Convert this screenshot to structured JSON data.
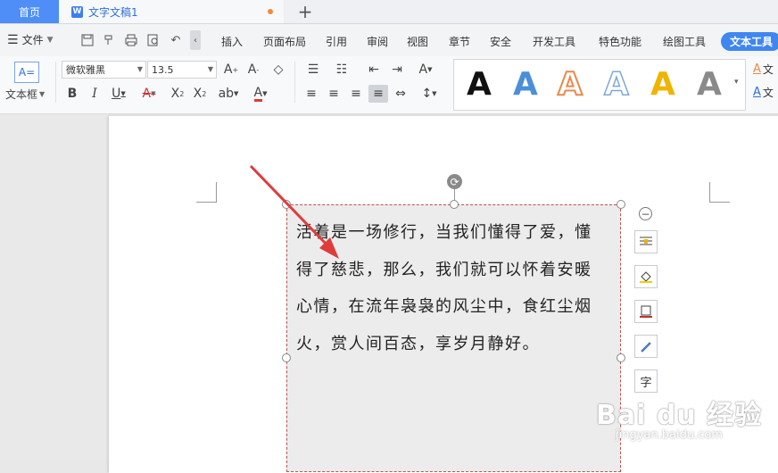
{
  "tabs": {
    "home": "首页",
    "document": "文字文稿1",
    "add": "+"
  },
  "menu": {
    "file": "文件",
    "tabs": [
      "插入",
      "页面布局",
      "引用",
      "审阅",
      "视图",
      "章节",
      "安全",
      "开发工具",
      "特色功能",
      "绘图工具",
      "文本工具"
    ],
    "active_tab": "文本工具"
  },
  "ribbon": {
    "textbox_label": "文本框",
    "font_name": "微软雅黑",
    "font_size": "13.5",
    "art_label_1": "文",
    "art_label_2": "文"
  },
  "art_styles": [
    {
      "glyph": "A",
      "color": "#111111",
      "style": "solid"
    },
    {
      "glyph": "A",
      "color": "#4a8fd8",
      "style": "solid"
    },
    {
      "glyph": "A",
      "color": "#e88a4a",
      "style": "outline"
    },
    {
      "glyph": "A",
      "color": "#7ea8d6",
      "style": "outline"
    },
    {
      "glyph": "A",
      "color": "#f0b400",
      "style": "solid"
    },
    {
      "glyph": "A",
      "color": "#777777",
      "style": "gradient"
    }
  ],
  "document": {
    "text_lines": [
      "活着是一场修行，当我们懂得了爱，懂",
      "得了慈悲，那么，我们就可以怀着安暖",
      "心情，在流年袅袅的风尘中，食红尘烟",
      "火，赏人间百态，享岁月静好。"
    ]
  },
  "side_tools": [
    "wrap-icon",
    "fill-icon",
    "outline-icon",
    "pen-icon",
    "text-icon"
  ],
  "side_tool_text": "字",
  "watermark": {
    "brand": "Bai du 经验",
    "url": "jingyan.baidu.com"
  },
  "colors": {
    "accent": "#4e8ef6",
    "arrow": "#e03b3b",
    "textbox_border": "#c0504d"
  }
}
